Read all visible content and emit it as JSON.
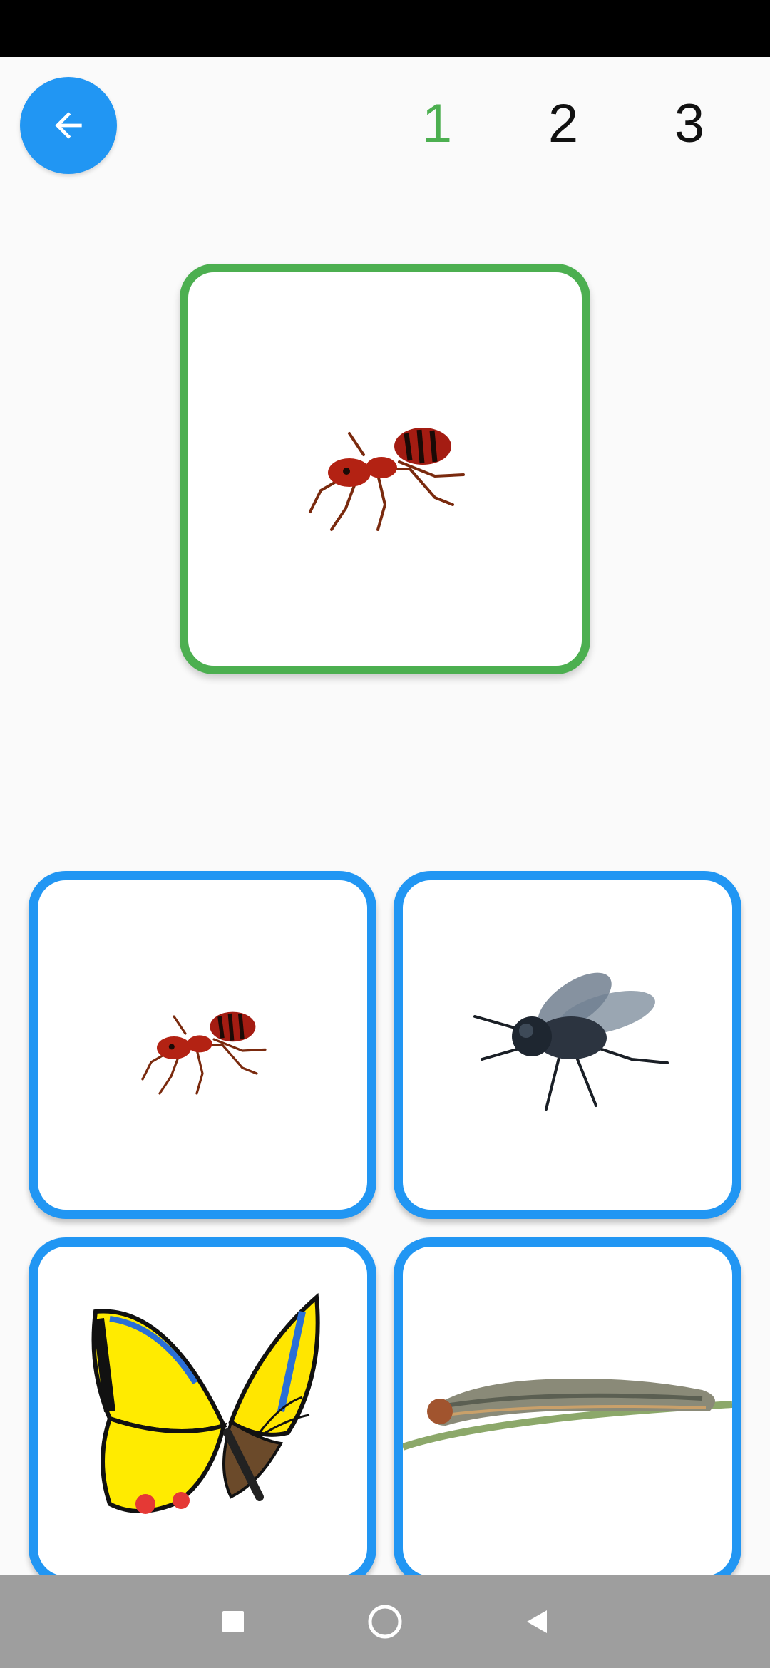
{
  "header": {
    "back_icon": "arrow-left-icon",
    "levels": [
      "1",
      "2",
      "3"
    ],
    "active_level": "1",
    "active_color": "#4caf50",
    "accent_color": "#2196f3"
  },
  "target": {
    "picture": "ant"
  },
  "choices": [
    {
      "picture": "ant"
    },
    {
      "picture": "fly"
    },
    {
      "picture": "butterfly"
    },
    {
      "picture": "caterpillar"
    }
  ],
  "nav_bar": {
    "recents_icon": "square-icon",
    "home_icon": "circle-icon",
    "back_icon": "triangle-back-icon"
  }
}
